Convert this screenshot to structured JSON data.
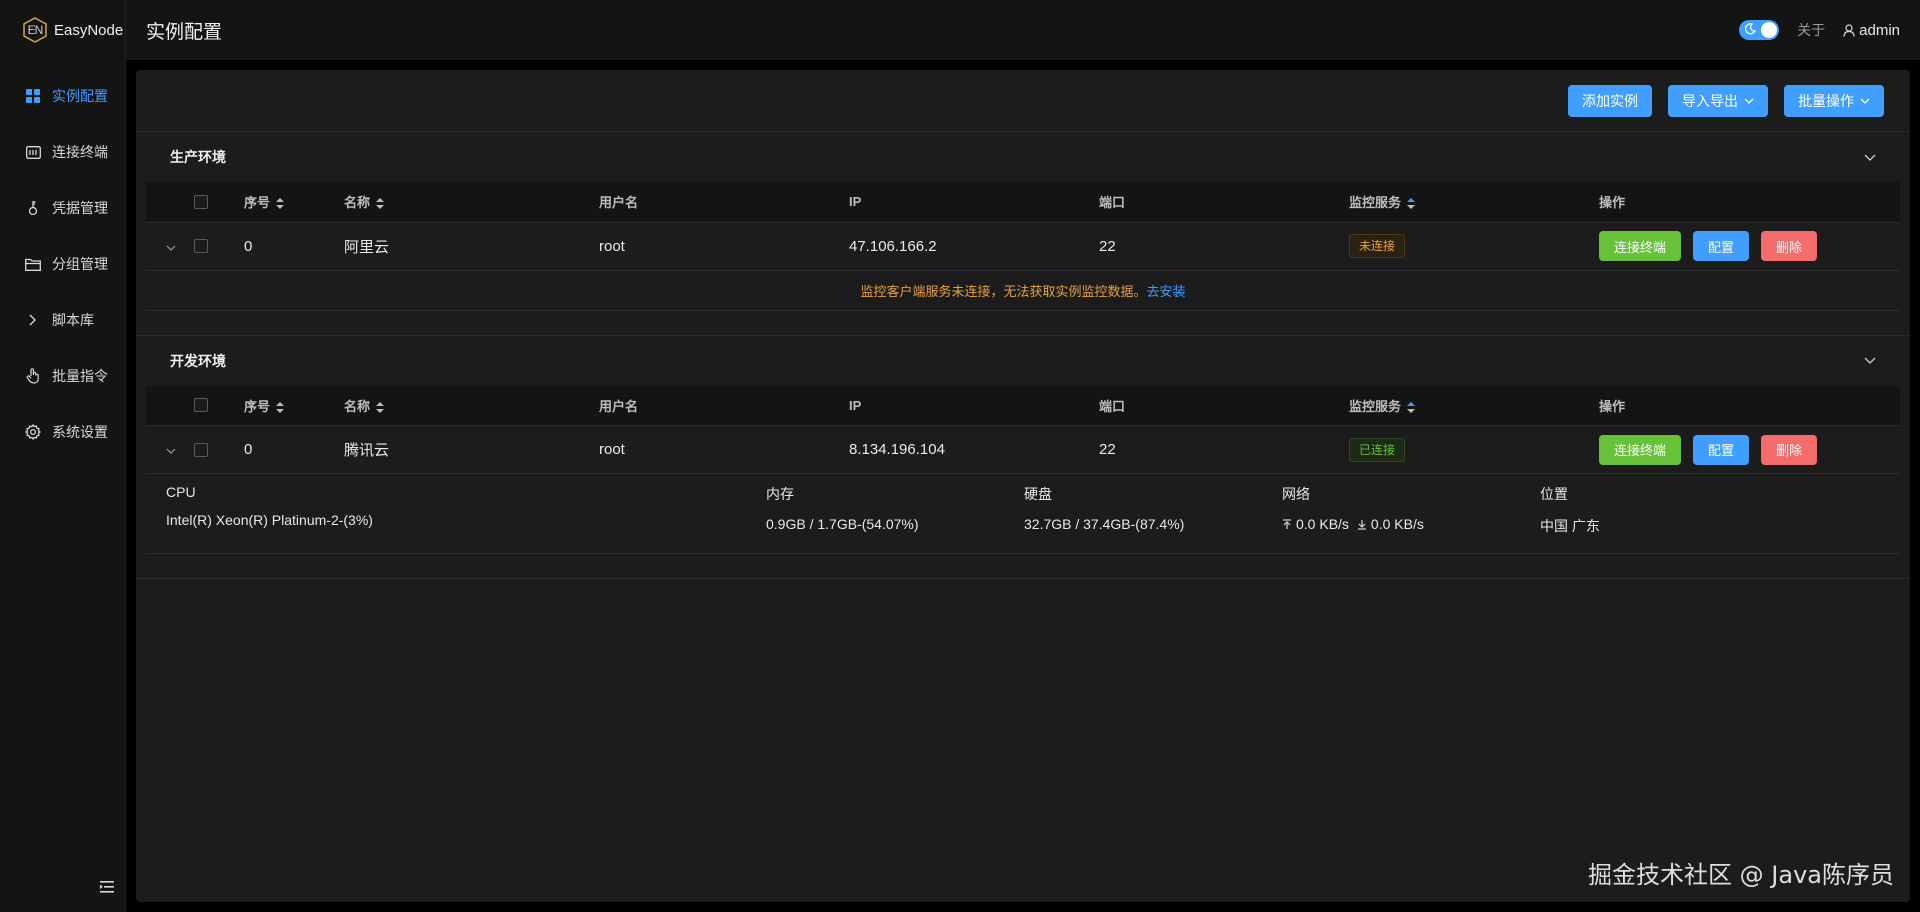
{
  "app": {
    "name": "EasyNode",
    "logo_letters": "EN"
  },
  "sidebar": {
    "items": [
      {
        "label": "实例配置",
        "icon": "grid-icon",
        "active": true
      },
      {
        "label": "连接终端",
        "icon": "terminal-icon",
        "active": false
      },
      {
        "label": "凭据管理",
        "icon": "key-icon",
        "active": false
      },
      {
        "label": "分组管理",
        "icon": "folder-icon",
        "active": false
      },
      {
        "label": "脚本库",
        "icon": "chevron-right-icon",
        "active": false
      },
      {
        "label": "批量指令",
        "icon": "hand-pointer-icon",
        "active": false
      },
      {
        "label": "系统设置",
        "icon": "gear-icon",
        "active": false
      }
    ]
  },
  "header": {
    "title": "实例配置",
    "about": "关于",
    "user": "admin",
    "dark_mode": true
  },
  "toolbar": {
    "add": "添加实例",
    "import_export": "导入导出",
    "batch": "批量操作"
  },
  "columns": [
    "序号",
    "名称",
    "用户名",
    "IP",
    "端口",
    "监控服务",
    "操作"
  ],
  "ops": {
    "connect": "连接终端",
    "config": "配置",
    "delete": "删除"
  },
  "groups": [
    {
      "title": "生产环境",
      "rows": [
        {
          "index": "0",
          "name": "阿里云",
          "username": "root",
          "ip": "47.106.166.2",
          "port": "22",
          "monitor": "未连接",
          "monitor_status": "disconnected"
        }
      ],
      "expand": {
        "warning": "监控客户端服务未连接，无法获取实例监控数据。",
        "install_link": "去安装"
      }
    },
    {
      "title": "开发环境",
      "rows": [
        {
          "index": "0",
          "name": "腾讯云",
          "username": "root",
          "ip": "8.134.196.104",
          "port": "22",
          "monitor": "已连接",
          "monitor_status": "connected"
        }
      ],
      "stats": {
        "cpu_label": "CPU",
        "cpu_value": "Intel(R) Xeon(R) Platinum-2-(3%)",
        "mem_label": "内存",
        "mem_value": "0.9GB / 1.7GB-(54.07%)",
        "disk_label": "硬盘",
        "disk_value": "32.7GB / 37.4GB-(87.4%)",
        "net_label": "网络",
        "net_up": "0.0 KB/s",
        "net_down": "0.0 KB/s",
        "loc_label": "位置",
        "loc_value": "中国 广东"
      }
    }
  ],
  "watermark": "掘金技术社区 @ Java陈序员",
  "colors": {
    "primary": "#409eff",
    "success": "#67c23a",
    "danger": "#f56c6c",
    "warning": "#e6a23c"
  }
}
